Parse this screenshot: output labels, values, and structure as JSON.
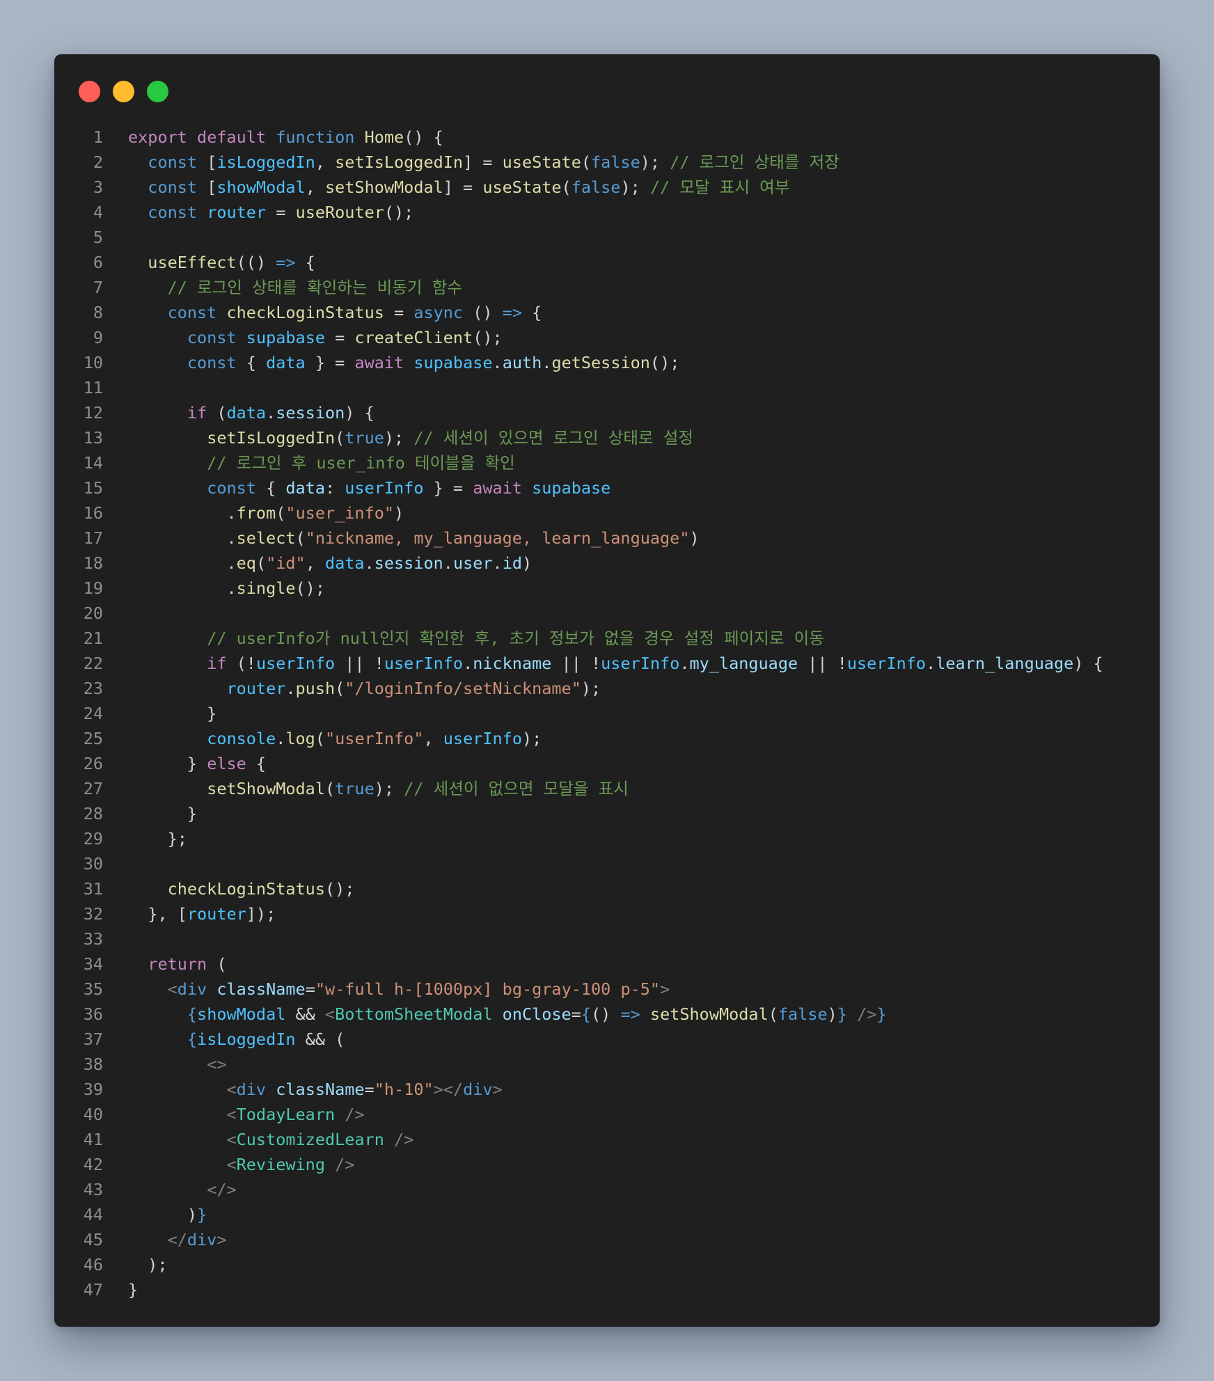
{
  "window": {
    "controls": [
      {
        "name": "close",
        "color": "#ff5f57"
      },
      {
        "name": "minimize",
        "color": "#febc2e"
      },
      {
        "name": "zoom",
        "color": "#28c840"
      }
    ]
  },
  "code": {
    "language": "javascript",
    "lines": [
      [
        [
          "kw",
          "export"
        ],
        [
          "t",
          " "
        ],
        [
          "kw",
          "default"
        ],
        [
          "t",
          " "
        ],
        [
          "st",
          "function"
        ],
        [
          "t",
          " "
        ],
        [
          "fn",
          "Home"
        ],
        [
          "t",
          "() {"
        ]
      ],
      [
        [
          "t",
          "  "
        ],
        [
          "st",
          "const"
        ],
        [
          "t",
          " ["
        ],
        [
          "var",
          "isLoggedIn"
        ],
        [
          "t",
          ", "
        ],
        [
          "fn",
          "setIsLoggedIn"
        ],
        [
          "t",
          "] = "
        ],
        [
          "fn",
          "useState"
        ],
        [
          "t",
          "("
        ],
        [
          "bool",
          "false"
        ],
        [
          "t",
          "); "
        ],
        [
          "cmt",
          "// 로그인 상태를 저장"
        ]
      ],
      [
        [
          "t",
          "  "
        ],
        [
          "st",
          "const"
        ],
        [
          "t",
          " ["
        ],
        [
          "var",
          "showModal"
        ],
        [
          "t",
          ", "
        ],
        [
          "fn",
          "setShowModal"
        ],
        [
          "t",
          "] = "
        ],
        [
          "fn",
          "useState"
        ],
        [
          "t",
          "("
        ],
        [
          "bool",
          "false"
        ],
        [
          "t",
          "); "
        ],
        [
          "cmt",
          "// 모달 표시 여부"
        ]
      ],
      [
        [
          "t",
          "  "
        ],
        [
          "st",
          "const"
        ],
        [
          "t",
          " "
        ],
        [
          "var",
          "router"
        ],
        [
          "t",
          " = "
        ],
        [
          "fn",
          "useRouter"
        ],
        [
          "t",
          "();"
        ]
      ],
      [],
      [
        [
          "t",
          "  "
        ],
        [
          "fn",
          "useEffect"
        ],
        [
          "t",
          "(() "
        ],
        [
          "st",
          "=>"
        ],
        [
          "t",
          " {"
        ]
      ],
      [
        [
          "t",
          "    "
        ],
        [
          "cmt",
          "// 로그인 상태를 확인하는 비동기 함수"
        ]
      ],
      [
        [
          "t",
          "    "
        ],
        [
          "st",
          "const"
        ],
        [
          "t",
          " "
        ],
        [
          "fn",
          "checkLoginStatus"
        ],
        [
          "t",
          " = "
        ],
        [
          "st",
          "async"
        ],
        [
          "t",
          " () "
        ],
        [
          "st",
          "=>"
        ],
        [
          "t",
          " {"
        ]
      ],
      [
        [
          "t",
          "      "
        ],
        [
          "st",
          "const"
        ],
        [
          "t",
          " "
        ],
        [
          "var",
          "supabase"
        ],
        [
          "t",
          " = "
        ],
        [
          "fn",
          "createClient"
        ],
        [
          "t",
          "();"
        ]
      ],
      [
        [
          "t",
          "      "
        ],
        [
          "st",
          "const"
        ],
        [
          "t",
          " { "
        ],
        [
          "var",
          "data"
        ],
        [
          "t",
          " } = "
        ],
        [
          "kw",
          "await"
        ],
        [
          "t",
          " "
        ],
        [
          "var",
          "supabase"
        ],
        [
          "t",
          "."
        ],
        [
          "prop",
          "auth"
        ],
        [
          "t",
          "."
        ],
        [
          "fn",
          "getSession"
        ],
        [
          "t",
          "();"
        ]
      ],
      [],
      [
        [
          "t",
          "      "
        ],
        [
          "kw",
          "if"
        ],
        [
          "t",
          " ("
        ],
        [
          "var",
          "data"
        ],
        [
          "t",
          "."
        ],
        [
          "prop",
          "session"
        ],
        [
          "t",
          ") {"
        ]
      ],
      [
        [
          "t",
          "        "
        ],
        [
          "fn",
          "setIsLoggedIn"
        ],
        [
          "t",
          "("
        ],
        [
          "bool",
          "true"
        ],
        [
          "t",
          "); "
        ],
        [
          "cmt",
          "// 세션이 있으면 로그인 상태로 설정"
        ]
      ],
      [
        [
          "t",
          "        "
        ],
        [
          "cmt",
          "// 로그인 후 user_info 테이블을 확인"
        ]
      ],
      [
        [
          "t",
          "        "
        ],
        [
          "st",
          "const"
        ],
        [
          "t",
          " { "
        ],
        [
          "prop",
          "data"
        ],
        [
          "t",
          ": "
        ],
        [
          "var",
          "userInfo"
        ],
        [
          "t",
          " } = "
        ],
        [
          "kw",
          "await"
        ],
        [
          "t",
          " "
        ],
        [
          "var",
          "supabase"
        ]
      ],
      [
        [
          "t",
          "          ."
        ],
        [
          "fn",
          "from"
        ],
        [
          "t",
          "("
        ],
        [
          "str",
          "\"user_info\""
        ],
        [
          "t",
          ")"
        ]
      ],
      [
        [
          "t",
          "          ."
        ],
        [
          "fn",
          "select"
        ],
        [
          "t",
          "("
        ],
        [
          "str",
          "\"nickname, my_language, learn_language\""
        ],
        [
          "t",
          ")"
        ]
      ],
      [
        [
          "t",
          "          ."
        ],
        [
          "fn",
          "eq"
        ],
        [
          "t",
          "("
        ],
        [
          "str",
          "\"id\""
        ],
        [
          "t",
          ", "
        ],
        [
          "var",
          "data"
        ],
        [
          "t",
          "."
        ],
        [
          "prop",
          "session"
        ],
        [
          "t",
          "."
        ],
        [
          "prop",
          "user"
        ],
        [
          "t",
          "."
        ],
        [
          "prop",
          "id"
        ],
        [
          "t",
          ")"
        ]
      ],
      [
        [
          "t",
          "          ."
        ],
        [
          "fn",
          "single"
        ],
        [
          "t",
          "();"
        ]
      ],
      [],
      [
        [
          "t",
          "        "
        ],
        [
          "cmt",
          "// userInfo가 null인지 확인한 후, 초기 정보가 없을 경우 설정 페이지로 이동"
        ]
      ],
      [
        [
          "t",
          "        "
        ],
        [
          "kw",
          "if"
        ],
        [
          "t",
          " (!"
        ],
        [
          "var",
          "userInfo"
        ],
        [
          "t",
          " || !"
        ],
        [
          "var",
          "userInfo"
        ],
        [
          "t",
          "."
        ],
        [
          "prop",
          "nickname"
        ],
        [
          "t",
          " || !"
        ],
        [
          "var",
          "userInfo"
        ],
        [
          "t",
          "."
        ],
        [
          "prop",
          "my_language"
        ],
        [
          "t",
          " || !"
        ],
        [
          "var",
          "userInfo"
        ],
        [
          "t",
          "."
        ],
        [
          "prop",
          "learn_language"
        ],
        [
          "t",
          ") {"
        ]
      ],
      [
        [
          "t",
          "          "
        ],
        [
          "var",
          "router"
        ],
        [
          "t",
          "."
        ],
        [
          "fn",
          "push"
        ],
        [
          "t",
          "("
        ],
        [
          "str",
          "\"/loginInfo/setNickname\""
        ],
        [
          "t",
          ");"
        ]
      ],
      [
        [
          "t",
          "        }"
        ]
      ],
      [
        [
          "t",
          "        "
        ],
        [
          "var",
          "console"
        ],
        [
          "t",
          "."
        ],
        [
          "fn",
          "log"
        ],
        [
          "t",
          "("
        ],
        [
          "str",
          "\"userInfo\""
        ],
        [
          "t",
          ", "
        ],
        [
          "var",
          "userInfo"
        ],
        [
          "t",
          ");"
        ]
      ],
      [
        [
          "t",
          "      } "
        ],
        [
          "kw",
          "else"
        ],
        [
          "t",
          " {"
        ]
      ],
      [
        [
          "t",
          "        "
        ],
        [
          "fn",
          "setShowModal"
        ],
        [
          "t",
          "("
        ],
        [
          "bool",
          "true"
        ],
        [
          "t",
          "); "
        ],
        [
          "cmt",
          "// 세션이 없으면 모달을 표시"
        ]
      ],
      [
        [
          "t",
          "      }"
        ]
      ],
      [
        [
          "t",
          "    };"
        ]
      ],
      [],
      [
        [
          "t",
          "    "
        ],
        [
          "fn",
          "checkLoginStatus"
        ],
        [
          "t",
          "();"
        ]
      ],
      [
        [
          "t",
          "  }, ["
        ],
        [
          "var",
          "router"
        ],
        [
          "t",
          "]);"
        ]
      ],
      [],
      [
        [
          "t",
          "  "
        ],
        [
          "kw",
          "return"
        ],
        [
          "t",
          " ("
        ]
      ],
      [
        [
          "t",
          "    "
        ],
        [
          "tagp",
          "<"
        ],
        [
          "tag",
          "div"
        ],
        [
          "t",
          " "
        ],
        [
          "attr",
          "className"
        ],
        [
          "t",
          "="
        ],
        [
          "str",
          "\"w-full h-[1000px] bg-gray-100 p-5\""
        ],
        [
          "tagp",
          ">"
        ]
      ],
      [
        [
          "t",
          "      "
        ],
        [
          "st",
          "{"
        ],
        [
          "var",
          "showModal"
        ],
        [
          "t",
          " && "
        ],
        [
          "tagp",
          "<"
        ],
        [
          "comp",
          "BottomSheetModal"
        ],
        [
          "t",
          " "
        ],
        [
          "attr",
          "onClose"
        ],
        [
          "t",
          "="
        ],
        [
          "st",
          "{"
        ],
        [
          "t",
          "() "
        ],
        [
          "st",
          "=>"
        ],
        [
          "t",
          " "
        ],
        [
          "fn",
          "setShowModal"
        ],
        [
          "t",
          "("
        ],
        [
          "bool",
          "false"
        ],
        [
          "t",
          ")"
        ],
        [
          "st",
          "}"
        ],
        [
          "t",
          " "
        ],
        [
          "tagp",
          "/>"
        ],
        [
          "st",
          "}"
        ]
      ],
      [
        [
          "t",
          "      "
        ],
        [
          "st",
          "{"
        ],
        [
          "var",
          "isLoggedIn"
        ],
        [
          "t",
          " && ("
        ]
      ],
      [
        [
          "t",
          "        "
        ],
        [
          "tagp",
          "<>"
        ]
      ],
      [
        [
          "t",
          "          "
        ],
        [
          "tagp",
          "<"
        ],
        [
          "tag",
          "div"
        ],
        [
          "t",
          " "
        ],
        [
          "attr",
          "className"
        ],
        [
          "t",
          "="
        ],
        [
          "str",
          "\"h-10\""
        ],
        [
          "tagp",
          "></"
        ],
        [
          "tag",
          "div"
        ],
        [
          "tagp",
          ">"
        ]
      ],
      [
        [
          "t",
          "          "
        ],
        [
          "tagp",
          "<"
        ],
        [
          "comp",
          "TodayLearn"
        ],
        [
          "t",
          " "
        ],
        [
          "tagp",
          "/>"
        ]
      ],
      [
        [
          "t",
          "          "
        ],
        [
          "tagp",
          "<"
        ],
        [
          "comp",
          "CustomizedLearn"
        ],
        [
          "t",
          " "
        ],
        [
          "tagp",
          "/>"
        ]
      ],
      [
        [
          "t",
          "          "
        ],
        [
          "tagp",
          "<"
        ],
        [
          "comp",
          "Reviewing"
        ],
        [
          "t",
          " "
        ],
        [
          "tagp",
          "/>"
        ]
      ],
      [
        [
          "t",
          "        "
        ],
        [
          "tagp",
          "</>"
        ]
      ],
      [
        [
          "t",
          "      )"
        ],
        [
          "st",
          "}"
        ]
      ],
      [
        [
          "t",
          "    "
        ],
        [
          "tagp",
          "</"
        ],
        [
          "tag",
          "div"
        ],
        [
          "tagp",
          ">"
        ]
      ],
      [
        [
          "t",
          "  );"
        ]
      ],
      [
        [
          "t",
          "}"
        ]
      ]
    ]
  }
}
